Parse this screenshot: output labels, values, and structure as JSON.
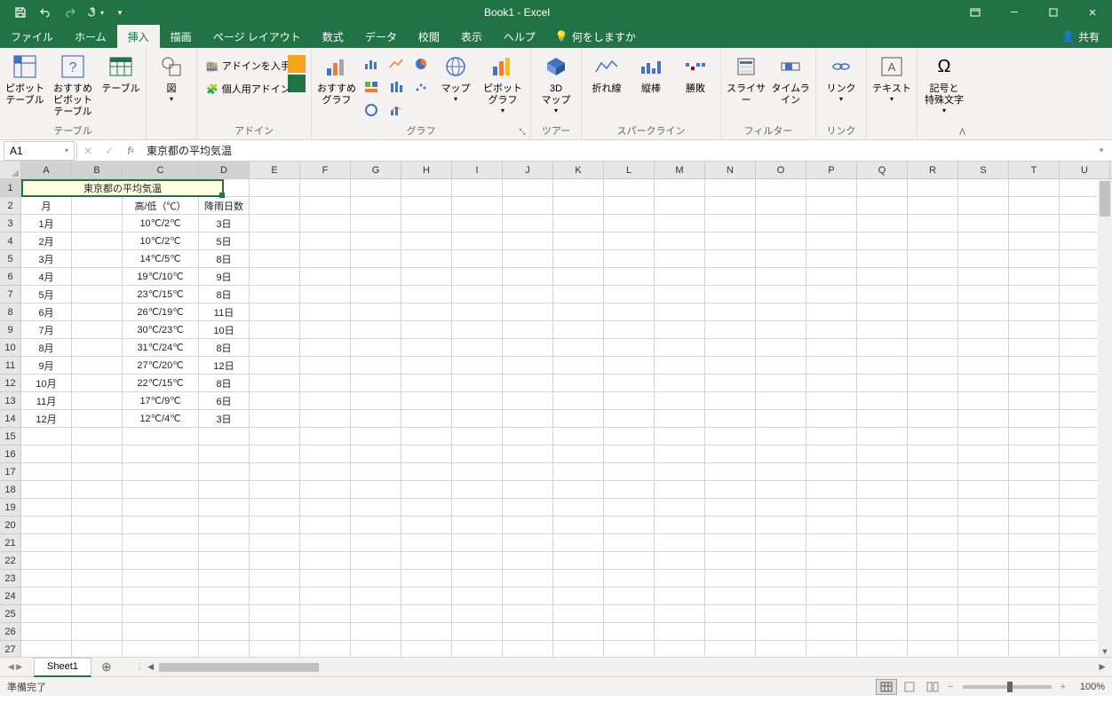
{
  "title": "Book1 - Excel",
  "share_label": "共有",
  "tabs": [
    "ファイル",
    "ホーム",
    "挿入",
    "描画",
    "ページ レイアウト",
    "数式",
    "データ",
    "校閲",
    "表示",
    "ヘルプ"
  ],
  "active_tab_index": 2,
  "tell_me_placeholder": "何をしますか",
  "ribbon": {
    "tables": {
      "label": "テーブル",
      "pivot": "ピボットテーブル",
      "recommended_pivot": "おすすめ\nピボットテーブル",
      "table": "テーブル"
    },
    "illustrations": {
      "label": "図",
      "illustrations": "図"
    },
    "addins": {
      "label": "アドイン",
      "get": "アドインを入手",
      "my": "個人用アドイン"
    },
    "charts": {
      "label": "グラフ",
      "recommended": "おすすめ\nグラフ",
      "maps": "マップ",
      "pivot_chart": "ピボットグラフ"
    },
    "tours": {
      "label": "ツアー",
      "map3d": "3D\nマップ"
    },
    "sparklines": {
      "label": "スパークライン",
      "line": "折れ線",
      "column": "縦棒",
      "winloss": "勝敗"
    },
    "filters": {
      "label": "フィルター",
      "slicer": "スライサー",
      "timeline": "タイムライン"
    },
    "links": {
      "label": "リンク",
      "link": "リンク"
    },
    "text": {
      "label": "",
      "text": "テキスト"
    },
    "symbols": {
      "label": "",
      "symbol": "記号と\n特殊文字"
    }
  },
  "name_box": "A1",
  "formula_value": "東京都の平均気温",
  "columns": [
    "A",
    "B",
    "C",
    "D",
    "E",
    "F",
    "G",
    "H",
    "I",
    "J",
    "K",
    "L",
    "M",
    "N",
    "O",
    "P",
    "Q",
    "R",
    "S",
    "T",
    "U"
  ],
  "selected_cols": [
    "A",
    "B",
    "C",
    "D"
  ],
  "row_count": 27,
  "selected_rows": [
    1
  ],
  "data": {
    "merged_title": "東京都の平均気温",
    "headers": {
      "A": "月",
      "BC": "高/低（℃）",
      "D": "降雨日数"
    },
    "rows": [
      {
        "A": "1月",
        "BC": "10℃/2℃",
        "D": "3日"
      },
      {
        "A": "2月",
        "BC": "10℃/2℃",
        "D": "5日"
      },
      {
        "A": "3月",
        "BC": "14℃/5℃",
        "D": "8日"
      },
      {
        "A": "4月",
        "BC": "19℃/10℃",
        "D": "9日"
      },
      {
        "A": "5月",
        "BC": "23℃/15℃",
        "D": "8日"
      },
      {
        "A": "6月",
        "BC": "26℃/19℃",
        "D": "11日"
      },
      {
        "A": "7月",
        "BC": "30℃/23℃",
        "D": "10日"
      },
      {
        "A": "8月",
        "BC": "31℃/24℃",
        "D": "8日"
      },
      {
        "A": "9月",
        "BC": "27℃/20℃",
        "D": "12日"
      },
      {
        "A": "10月",
        "BC": "22℃/15℃",
        "D": "8日"
      },
      {
        "A": "11月",
        "BC": "17℃/9℃",
        "D": "6日"
      },
      {
        "A": "12月",
        "BC": "12℃/4℃",
        "D": "3日"
      }
    ]
  },
  "sheet_tab": "Sheet1",
  "status": "準備完了",
  "zoom": "100%"
}
